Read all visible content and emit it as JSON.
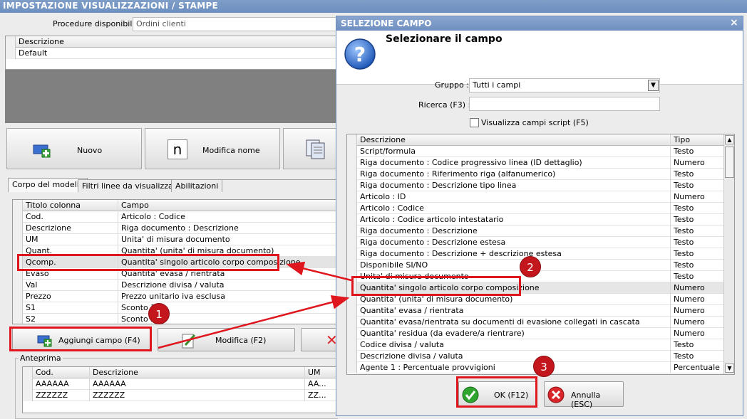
{
  "bg_window": {
    "title": "IMPOSTAZIONE VISUALIZZAZIONI / STAMPE",
    "procedure_label": "Procedure disponibili",
    "procedure_value": "Ordini clienti",
    "top_grid": {
      "header": "Descrizione",
      "rows": [
        "Default"
      ]
    },
    "buttons": {
      "nuovo": "Nuovo",
      "modifica_nome": "Modifica nome"
    },
    "tabs": [
      "Corpo del modello",
      "Filtri linee da visualizzare",
      "Abilitazioni"
    ],
    "fields_grid": {
      "headers": [
        "Titolo colonna",
        "Campo"
      ],
      "rows": [
        [
          "Cod.",
          "Articolo : Codice"
        ],
        [
          "Descrizione",
          "Riga documento : Descrizione"
        ],
        [
          "UM",
          "Unita' di misura documento"
        ],
        [
          "Quant.",
          "Quantita' (unita' di misura documento)"
        ],
        [
          "Qcomp.",
          "Quantita' singolo articolo corpo composizione"
        ],
        [
          "Evaso",
          "Quantita' evasa / rientrata"
        ],
        [
          "Val",
          "Descrizione divisa / valuta"
        ],
        [
          "Prezzo",
          "Prezzo unitario iva esclusa"
        ],
        [
          "S1",
          "Sconto 1"
        ],
        [
          "S2",
          "Sconto 2"
        ]
      ]
    },
    "action_buttons": {
      "aggiungi": "Aggiungi campo (F4)",
      "modifica": "Modifica (F2)"
    },
    "preview": {
      "label": "Anteprima",
      "headers": [
        "Cod.",
        "Descrizione",
        "UM"
      ],
      "rows": [
        [
          "AAAAAA",
          "AAAAAA",
          "AA..."
        ],
        [
          "ZZZZZZ",
          "ZZZZZZ",
          "ZZ..."
        ]
      ]
    }
  },
  "dialog": {
    "title": "SELEZIONE CAMPO",
    "close": "×",
    "heading": "Selezionare il campo",
    "gruppo_label": "Gruppo :",
    "gruppo_value": "Tutti i campi",
    "ricerca_label": "Ricerca (F3) :",
    "ricerca_value": "",
    "script_checkbox": "Visualizza campi script (F5)",
    "list_headers": [
      "Descrizione",
      "Tipo"
    ],
    "list_rows": [
      [
        "Script/formula",
        "Testo"
      ],
      [
        "Riga documento : Codice progressivo linea (ID dettaglio)",
        "Numero"
      ],
      [
        "Riga documento : Riferimento riga (alfanumerico)",
        "Testo"
      ],
      [
        "Riga documento : Descrizione tipo linea",
        "Testo"
      ],
      [
        "Articolo : ID",
        "Numero"
      ],
      [
        "Articolo : Codice",
        "Testo"
      ],
      [
        "Articolo : Codice articolo intestatario",
        "Testo"
      ],
      [
        "Riga documento : Descrizione",
        "Testo"
      ],
      [
        "Riga documento : Descrizione estesa",
        "Testo"
      ],
      [
        "Riga documento : Descrizione + descrizione estesa",
        "Testo"
      ],
      [
        "Disponibile SI/NO",
        "Testo"
      ],
      [
        "Unita' di misura documento",
        "Testo"
      ],
      [
        "Quantita' singolo articolo corpo composizione",
        "Numero"
      ],
      [
        "Quantita' (unita' di misura documento)",
        "Numero"
      ],
      [
        "Quantita' evasa / rientrata",
        "Numero"
      ],
      [
        "Quantita' evasa/rientrata su documenti di evasione collegati in cascata",
        "Numero"
      ],
      [
        "Quantita' residua (da evadere/a rientrare)",
        "Numero"
      ],
      [
        "Codice divisa / valuta",
        "Testo"
      ],
      [
        "Descrizione divisa / valuta",
        "Testo"
      ],
      [
        "Agente 1 : Percentuale provvigioni",
        "Percentuale"
      ]
    ],
    "ok_button": "OK (F12)",
    "cancel_button": "Annulla (ESC)"
  },
  "annotations": {
    "badge1": "1",
    "badge2": "2",
    "badge3": "3",
    "accent": "#e0161e"
  }
}
